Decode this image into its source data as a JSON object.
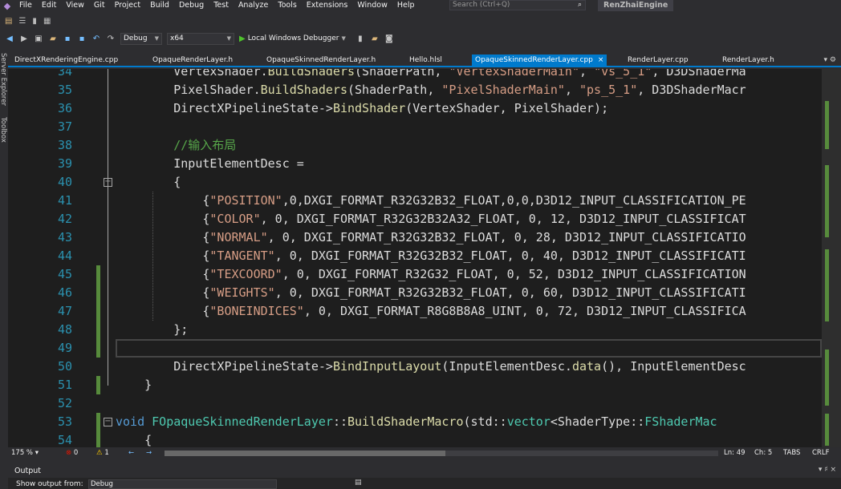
{
  "menubar": {
    "items": [
      "File",
      "Edit",
      "View",
      "Git",
      "Project",
      "Build",
      "Debug",
      "Test",
      "Analyze",
      "Tools",
      "Extensions",
      "Window",
      "Help"
    ],
    "search_placeholder": "Search (Ctrl+Q)",
    "solution_name": "RenZhaiEngine"
  },
  "toolbar": {
    "config": "Debug",
    "platform": "x64",
    "debugger_label": "Local Windows Debugger"
  },
  "side_rail": {
    "server_explorer": "Server Explorer",
    "toolbox": "Toolbox"
  },
  "tabs": [
    {
      "label": "DirectXRenderingEngine.cpp",
      "active": false
    },
    {
      "label": "OpaqueRenderLayer.h",
      "active": false
    },
    {
      "label": "OpaqueSkinnedRenderLayer.h",
      "active": false
    },
    {
      "label": "Hello.hlsl",
      "active": false
    },
    {
      "label": "OpaqueSkinnedRenderLayer.cpp",
      "active": true
    },
    {
      "label": "RenderLayer.cpp",
      "active": false
    },
    {
      "label": "RenderLayer.h",
      "active": false
    }
  ],
  "tab_close_glyph": "×",
  "tab_tools_glyphs": "▾ ⚙",
  "editor": {
    "line_numbers": [
      "34",
      "35",
      "36",
      "37",
      "38",
      "39",
      "40",
      "41",
      "42",
      "43",
      "44",
      "45",
      "46",
      "47",
      "48",
      "49",
      "50",
      "51",
      "52",
      "53",
      "54"
    ],
    "lines": [
      [
        [
          "        ",
          "c-default"
        ],
        [
          "VertexShader",
          "c-default"
        ],
        [
          ".",
          "c-default"
        ],
        [
          "BuildShaders",
          "c-func"
        ],
        [
          "(ShaderPath, ",
          "c-default"
        ],
        [
          "\"VertexShaderMain\"",
          "c-string"
        ],
        [
          ", ",
          "c-default"
        ],
        [
          "\"vs_5_1\"",
          "c-string"
        ],
        [
          ", D3DShaderMa",
          "c-default"
        ]
      ],
      [
        [
          "        ",
          "c-default"
        ],
        [
          "PixelShader",
          "c-default"
        ],
        [
          ".",
          "c-default"
        ],
        [
          "BuildShaders",
          "c-func"
        ],
        [
          "(ShaderPath, ",
          "c-default"
        ],
        [
          "\"PixelShaderMain\"",
          "c-string"
        ],
        [
          ", ",
          "c-default"
        ],
        [
          "\"ps_5_1\"",
          "c-string"
        ],
        [
          ", D3DShaderMacr",
          "c-default"
        ]
      ],
      [
        [
          "        ",
          "c-default"
        ],
        [
          "DirectXPipelineState->",
          "c-default"
        ],
        [
          "BindShader",
          "c-func"
        ],
        [
          "(VertexShader, PixelShader);",
          "c-default"
        ]
      ],
      [
        [
          "",
          "c-default"
        ]
      ],
      [
        [
          "        ",
          "c-default"
        ],
        [
          "//输入布局",
          "c-comment"
        ]
      ],
      [
        [
          "        ",
          "c-default"
        ],
        [
          "InputElementDesc =",
          "c-default"
        ]
      ],
      [
        [
          "        ",
          "c-default"
        ],
        [
          "{",
          "c-default"
        ]
      ],
      [
        [
          "            ",
          "c-default"
        ],
        [
          "{",
          "c-default"
        ],
        [
          "\"POSITION\"",
          "c-string"
        ],
        [
          ",0,DXGI_FORMAT_R32G32B32_FLOAT,0,0,D3D12_INPUT_CLASSIFICATION_PE",
          "c-default"
        ]
      ],
      [
        [
          "            ",
          "c-default"
        ],
        [
          "{",
          "c-default"
        ],
        [
          "\"COLOR\"",
          "c-string"
        ],
        [
          ", 0, DXGI_FORMAT_R32G32B32A32_FLOAT, 0, 12, D3D12_INPUT_CLASSIFICAT",
          "c-default"
        ]
      ],
      [
        [
          "            ",
          "c-default"
        ],
        [
          "{",
          "c-default"
        ],
        [
          "\"NORMAL\"",
          "c-string"
        ],
        [
          ", 0, DXGI_FORMAT_R32G32B32_FLOAT, 0, 28, D3D12_INPUT_CLASSIFICATIO",
          "c-default"
        ]
      ],
      [
        [
          "            ",
          "c-default"
        ],
        [
          "{",
          "c-default"
        ],
        [
          "\"TANGENT\"",
          "c-string"
        ],
        [
          ", 0, DXGI_FORMAT_R32G32B32_FLOAT, 0, 40, D3D12_INPUT_CLASSIFICATI",
          "c-default"
        ]
      ],
      [
        [
          "            ",
          "c-default"
        ],
        [
          "{",
          "c-default"
        ],
        [
          "\"TEXCOORD\"",
          "c-string"
        ],
        [
          ", 0, DXGI_FORMAT_R32G32_FLOAT, 0, 52, D3D12_INPUT_CLASSIFICATION",
          "c-default"
        ]
      ],
      [
        [
          "            ",
          "c-default"
        ],
        [
          "{",
          "c-default"
        ],
        [
          "\"WEIGHTS\"",
          "c-string"
        ],
        [
          ", 0, DXGI_FORMAT_R32G32B32_FLOAT, 0, 60, D3D12_INPUT_CLASSIFICATI",
          "c-default"
        ]
      ],
      [
        [
          "            ",
          "c-default"
        ],
        [
          "{",
          "c-default"
        ],
        [
          "\"BONEINDICES\"",
          "c-string"
        ],
        [
          ", 0, DXGI_FORMAT_R8G8B8A8_UINT, 0, 72, D3D12_INPUT_CLASSIFICA",
          "c-default"
        ]
      ],
      [
        [
          "        ",
          "c-default"
        ],
        [
          "};",
          "c-default"
        ]
      ],
      [
        [
          "",
          "c-default"
        ]
      ],
      [
        [
          "        ",
          "c-default"
        ],
        [
          "DirectXPipelineState->",
          "c-default"
        ],
        [
          "BindInputLayout",
          "c-func"
        ],
        [
          "(InputElementDesc.",
          "c-default"
        ],
        [
          "data",
          "c-func"
        ],
        [
          "(), InputElementDesc",
          "c-default"
        ]
      ],
      [
        [
          "    ",
          "c-default"
        ],
        [
          "}",
          "c-default"
        ]
      ],
      [
        [
          "",
          "c-default"
        ]
      ],
      [
        [
          "",
          "c-default"
        ],
        [
          "void",
          "c-keyword"
        ],
        [
          " ",
          "c-default"
        ],
        [
          "FOpaqueSkinnedRenderLayer",
          "c-type"
        ],
        [
          "::",
          "c-default"
        ],
        [
          "BuildShaderMacro",
          "c-func"
        ],
        [
          "(std::",
          "c-default"
        ],
        [
          "vector",
          "c-type"
        ],
        [
          "<ShaderType::",
          "c-default"
        ],
        [
          "FShaderMac",
          "c-type"
        ]
      ],
      [
        [
          "    ",
          "c-default"
        ],
        [
          "{",
          "c-default"
        ]
      ]
    ]
  },
  "status": {
    "zoom": "175 %",
    "errors": "0",
    "warnings": "1",
    "line": "Ln: 49",
    "col": "Ch: 5",
    "tabs": "TABS",
    "eol": "CRLF"
  },
  "output": {
    "title": "Output",
    "show_from_label": "Show output from:",
    "source": "Debug",
    "header_tools": "▾ ♯ ×"
  }
}
